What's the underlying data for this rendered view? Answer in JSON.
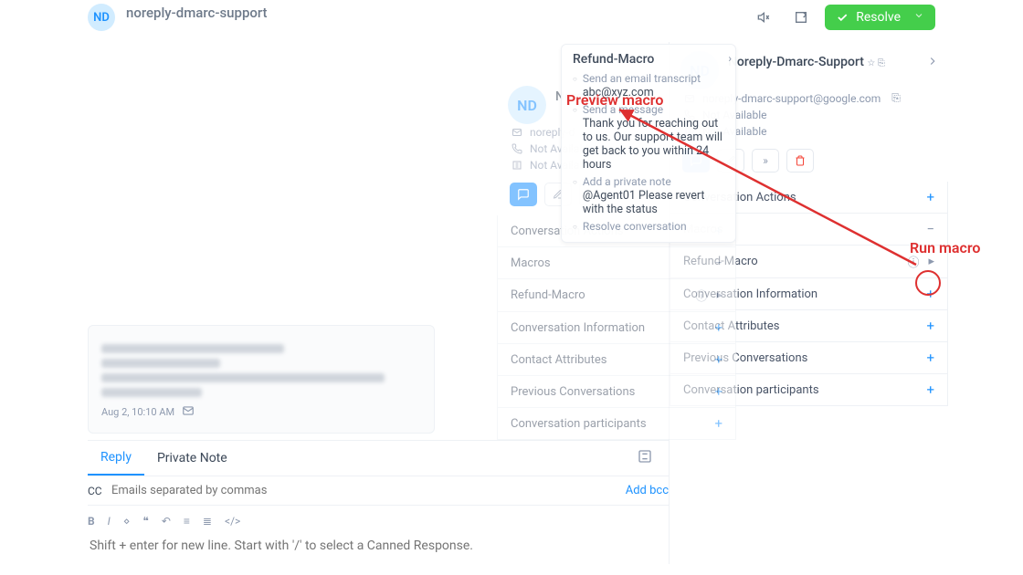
{
  "top": {
    "avatar": "ND",
    "title": "noreply-dmarc-support",
    "resolve": "Resolve"
  },
  "message": {
    "time": "Aug 2, 10:10 AM"
  },
  "compose": {
    "tab_reply": "Reply",
    "tab_note": "Private Note",
    "cc_label": "CC",
    "cc_placeholder": "Emails separated by commas",
    "addbcc": "Add bcc",
    "editor_placeholder": "Shift + enter for new line. Start with '/' to select a Canned Response."
  },
  "side": {
    "avatar": "ND",
    "name": "Noreply-Dmarc-Support",
    "email": "noreply-dmarc-support@google.com",
    "phone": "Not Available",
    "company": "Not Available",
    "sections": {
      "conv_actions": "Conversation Actions",
      "macros": "Macros",
      "refund_macro": "Refund-Macro",
      "conv_info": "Conversation Information",
      "contact_attr": "Contact Attributes",
      "prev_conv": "Previous Conversations",
      "participants": "Conversation participants"
    }
  },
  "ghost": {
    "title": "Refund-Macro",
    "name": "Noreply-Dmarc-Support",
    "not_avail": "Not Available",
    "step1_label": "Send an email transcript",
    "step1_value": "abc@xyz.com",
    "step2_label": "Send a message",
    "step2_value": "Thank you for reaching out to us. Our support team will get back to you within 24 hours",
    "step3_label": "Add a private note",
    "step3_value": "@Agent01 Please revert with the status",
    "step4_label": "Resolve conversation"
  },
  "annot": {
    "preview": "Preview macro",
    "run": "Run macro"
  }
}
